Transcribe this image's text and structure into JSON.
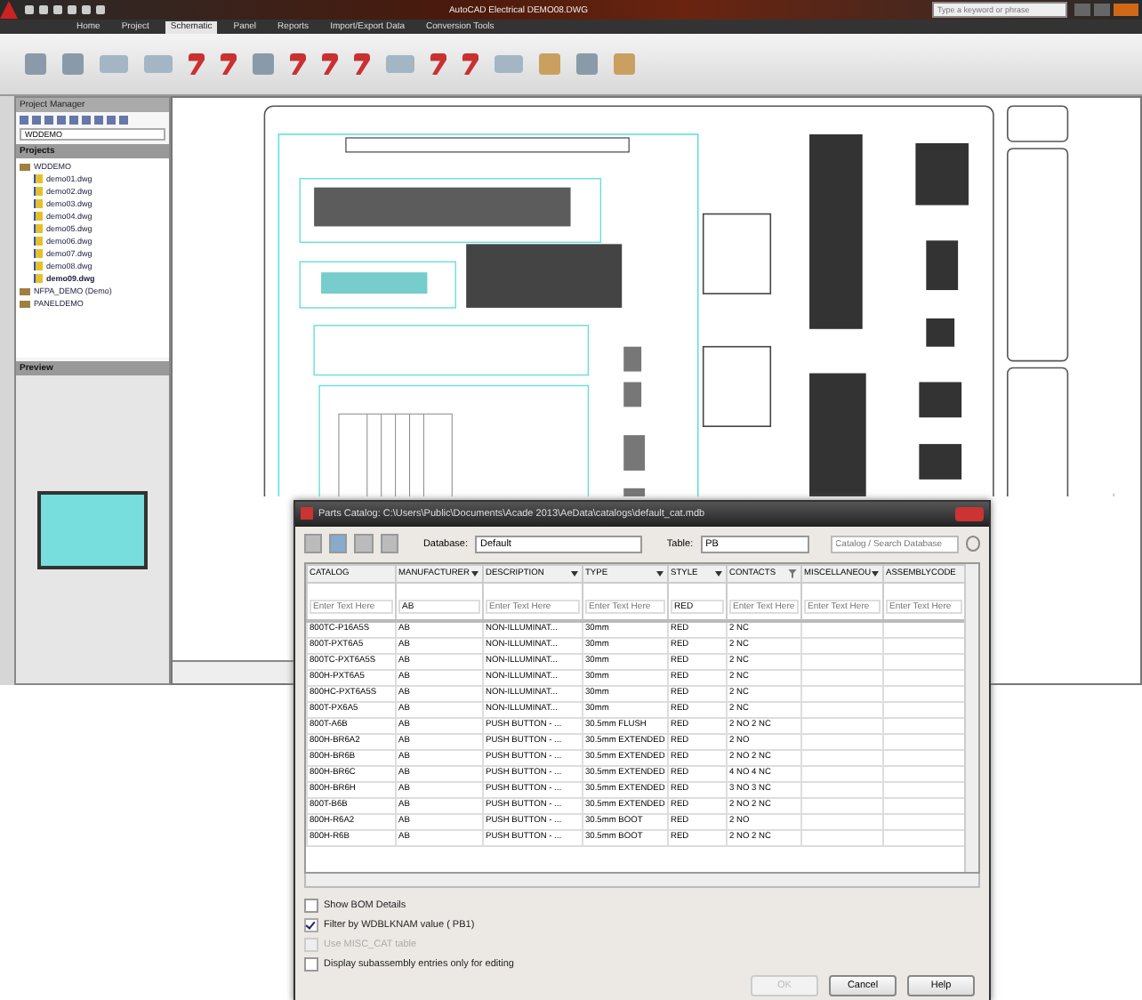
{
  "app": {
    "title": "AutoCAD Electrical  DEMO08.DWG",
    "search": {
      "placeholder": "Type a keyword or phrase"
    },
    "tabs": [
      {
        "label": "Home",
        "selected": false
      },
      {
        "label": "Project",
        "selected": false
      },
      {
        "label": "Schematic",
        "selected": true
      },
      {
        "label": "Panel",
        "selected": false
      },
      {
        "label": "Reports",
        "selected": false
      },
      {
        "label": "Import/Export Data",
        "selected": false
      },
      {
        "label": "Conversion Tools",
        "selected": false
      }
    ]
  },
  "project_manager": {
    "title": "Project Manager",
    "project_select": "WDDEMO",
    "projects_header": "Projects",
    "tree": [
      {
        "label": "WDDEMO",
        "active": false,
        "children": [
          {
            "label": "demo01.dwg",
            "active": false
          },
          {
            "label": "demo02.dwg",
            "active": false
          },
          {
            "label": "demo03.dwg",
            "active": false
          },
          {
            "label": "demo04.dwg",
            "active": false
          },
          {
            "label": "demo05.dwg",
            "active": false
          },
          {
            "label": "demo06.dwg",
            "active": false
          },
          {
            "label": "demo07.dwg",
            "active": false
          },
          {
            "label": "demo08.dwg",
            "active": false
          },
          {
            "label": "demo09.dwg",
            "active": true
          }
        ]
      },
      {
        "label": "NFPA_DEMO (Demo)",
        "active": false
      },
      {
        "label": "PANELDEMO",
        "active": false
      }
    ],
    "preview_header": "Preview"
  },
  "dialog": {
    "title": "Parts Catalog: C:\\Users\\Public\\Documents\\Acade 2013\\AeData\\catalogs\\default_cat.mdb",
    "database_label": "Database:",
    "database": "Default",
    "table_label": "Table:",
    "table": "PB",
    "search": {
      "placeholder": "Catalog / Search Database"
    },
    "columns": [
      {
        "label": "CATALOG",
        "menu": false,
        "filtered": false,
        "filter": {
          "placeholder": "Enter Text Here"
        }
      },
      {
        "label": "MANUFACTURER",
        "menu": true,
        "filtered": false,
        "filter": {
          "value": "AB"
        }
      },
      {
        "label": "DESCRIPTION",
        "menu": true,
        "filtered": false,
        "filter": {
          "placeholder": "Enter Text Here"
        }
      },
      {
        "label": "TYPE",
        "menu": true,
        "filtered": false,
        "filter": {
          "placeholder": "Enter Text Here"
        }
      },
      {
        "label": "STYLE",
        "menu": true,
        "filtered": false,
        "filter": {
          "value": "RED"
        }
      },
      {
        "label": "CONTACTS",
        "menu": false,
        "filtered": true,
        "filter": {
          "placeholder": "Enter Text Here"
        }
      },
      {
        "label": "MISCELLANEOU",
        "menu": true,
        "filtered": false,
        "filter": {
          "placeholder": "Enter Text Here"
        }
      },
      {
        "label": "ASSEMBLYCODE",
        "menu": false,
        "filtered": false,
        "filter": {
          "placeholder": "Enter Text Here"
        }
      }
    ],
    "rows": [
      [
        "800TC-P16A5S",
        "AB",
        "NON-ILLUMINAT...",
        "30mm",
        "RED",
        "2 NC"
      ],
      [
        "800T-PXT6A5",
        "AB",
        "NON-ILLUMINAT...",
        "30mm",
        "RED",
        "2 NC"
      ],
      [
        "800TC-PXT6A5S",
        "AB",
        "NON-ILLUMINAT...",
        "30mm",
        "RED",
        "2 NC"
      ],
      [
        "800H-PXT6A5",
        "AB",
        "NON-ILLUMINAT...",
        "30mm",
        "RED",
        "2 NC"
      ],
      [
        "800HC-PXT6A5S",
        "AB",
        "NON-ILLUMINAT...",
        "30mm",
        "RED",
        "2 NC"
      ],
      [
        "800T-PX6A5",
        "AB",
        "NON-ILLUMINAT...",
        "30mm",
        "RED",
        "2 NC"
      ],
      [
        "800T-A6B",
        "AB",
        "PUSH BUTTON - ...",
        "30.5mm FLUSH",
        "RED",
        "2 NO 2 NC"
      ],
      [
        "800H-BR6A2",
        "AB",
        "PUSH BUTTON - ...",
        "30.5mm EXTENDED",
        "RED",
        "2 NO"
      ],
      [
        "800H-BR6B",
        "AB",
        "PUSH BUTTON - ...",
        "30.5mm EXTENDED",
        "RED",
        "2 NO 2 NC"
      ],
      [
        "800H-BR6C",
        "AB",
        "PUSH BUTTON - ...",
        "30.5mm EXTENDED",
        "RED",
        "4 NO 4 NC"
      ],
      [
        "800H-BR6H",
        "AB",
        "PUSH BUTTON - ...",
        "30.5mm EXTENDED",
        "RED",
        "3 NO 3 NC"
      ],
      [
        "800T-B6B",
        "AB",
        "PUSH BUTTON - ...",
        "30.5mm EXTENDED",
        "RED",
        "2 NO 2 NC"
      ],
      [
        "800H-R6A2",
        "AB",
        "PUSH BUTTON - ...",
        "30.5mm BOOT",
        "RED",
        "2 NO"
      ],
      [
        "800H-R6B",
        "AB",
        "PUSH BUTTON - ...",
        "30.5mm BOOT",
        "RED",
        "2 NO 2 NC"
      ]
    ],
    "options": [
      {
        "label": "Show BOM Details",
        "checked": false,
        "disabled": false
      },
      {
        "label": "Filter by WDBLKNAM value ( PB1)",
        "checked": true,
        "disabled": false
      },
      {
        "label": "Use MISC_CAT table",
        "checked": false,
        "disabled": true
      },
      {
        "label": "Display subassembly entries only for editing",
        "checked": false,
        "disabled": false
      }
    ],
    "buttons": [
      {
        "label": "OK",
        "disabled": true
      },
      {
        "label": "Cancel",
        "disabled": false
      },
      {
        "label": "Help",
        "disabled": false
      }
    ]
  }
}
